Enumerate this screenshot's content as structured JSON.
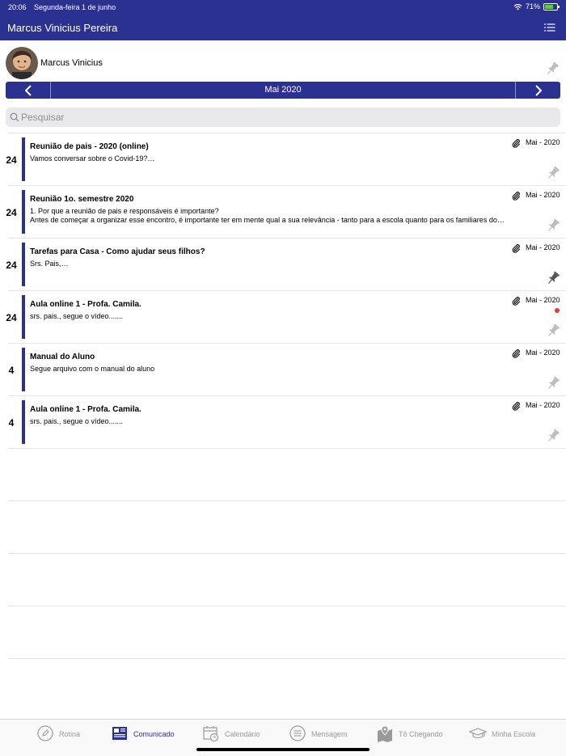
{
  "status_bar": {
    "time": "20:06",
    "date": "Segunda-feira 1 de junho",
    "battery": "71%",
    "battery_level": 0.71,
    "wifi_icon": "wifi-icon"
  },
  "header": {
    "title": "Marcus Vinicius Pereira",
    "menu_icon": "list-icon"
  },
  "profile": {
    "name": "Marcus Vinicius",
    "avatar": "avatar"
  },
  "month": {
    "label": "Mai 2020",
    "prev_icon": "chevron-left-icon",
    "next_icon": "chevron-right-icon"
  },
  "search": {
    "placeholder": "Pesquisar",
    "value": ""
  },
  "items": [
    {
      "day": "24",
      "title": "Reunião de pais  - 2020 (online)",
      "preview": [
        "Vamos conversar sobre o Covid-19?…"
      ],
      "date": "Mai - 2020",
      "attachment": true,
      "pinned": false
    },
    {
      "day": "24",
      "title": "Reunião 1o. semestre 2020",
      "preview": [
        "1. Por que a reunião de pais e responsáveis é importante?",
        "Antes de começar a organizar esse encontro, é importante ter em mente qual a sua relevância - tanto para a escola quanto para os familiares do…"
      ],
      "date": "Mai - 2020",
      "attachment": true,
      "pinned": false
    },
    {
      "day": "24",
      "title": "Tarefas para Casa - Como ajudar seus filhos?",
      "preview": [
        "Srs. Pais,…"
      ],
      "date": "Mai - 2020",
      "attachment": true,
      "pinned": true
    },
    {
      "day": "24",
      "title": "Aula online 1 - Profa. Camila.",
      "preview": [
        "srs. pais., segue o vídeo.......",
        ""
      ],
      "date": "Mai - 2020",
      "attachment": true,
      "pinned": false,
      "unread": true
    },
    {
      "day": "4",
      "title": "Manual do Aluno",
      "preview": [
        "Segue arquivo com o manual do aluno"
      ],
      "date": "Mai - 2020",
      "attachment": true,
      "pinned": false
    },
    {
      "day": "4",
      "title": "Aula online 1 - Profa. Camila.",
      "preview": [
        "srs. pais., segue o vídeo......."
      ],
      "date": "Mai - 2020",
      "attachment": true,
      "pinned": false
    }
  ],
  "tabs": [
    {
      "label": "Rotina",
      "icon": "pencil-icon",
      "active": false
    },
    {
      "label": "Comunicado",
      "icon": "newspaper-icon",
      "active": true
    },
    {
      "label": "Calendário",
      "icon": "calendar-icon",
      "active": false
    },
    {
      "label": "Mensagem",
      "icon": "message-icon",
      "active": false
    },
    {
      "label": "Tô Chegando",
      "icon": "map-pin-icon",
      "active": false
    },
    {
      "label": "Minha Escola",
      "icon": "graduation-cap-icon",
      "active": false
    }
  ],
  "colors": {
    "brand": "#2b3190",
    "unread": "#e53935",
    "pin_active": "#555555",
    "pin_inactive": "#bdbdbd"
  }
}
